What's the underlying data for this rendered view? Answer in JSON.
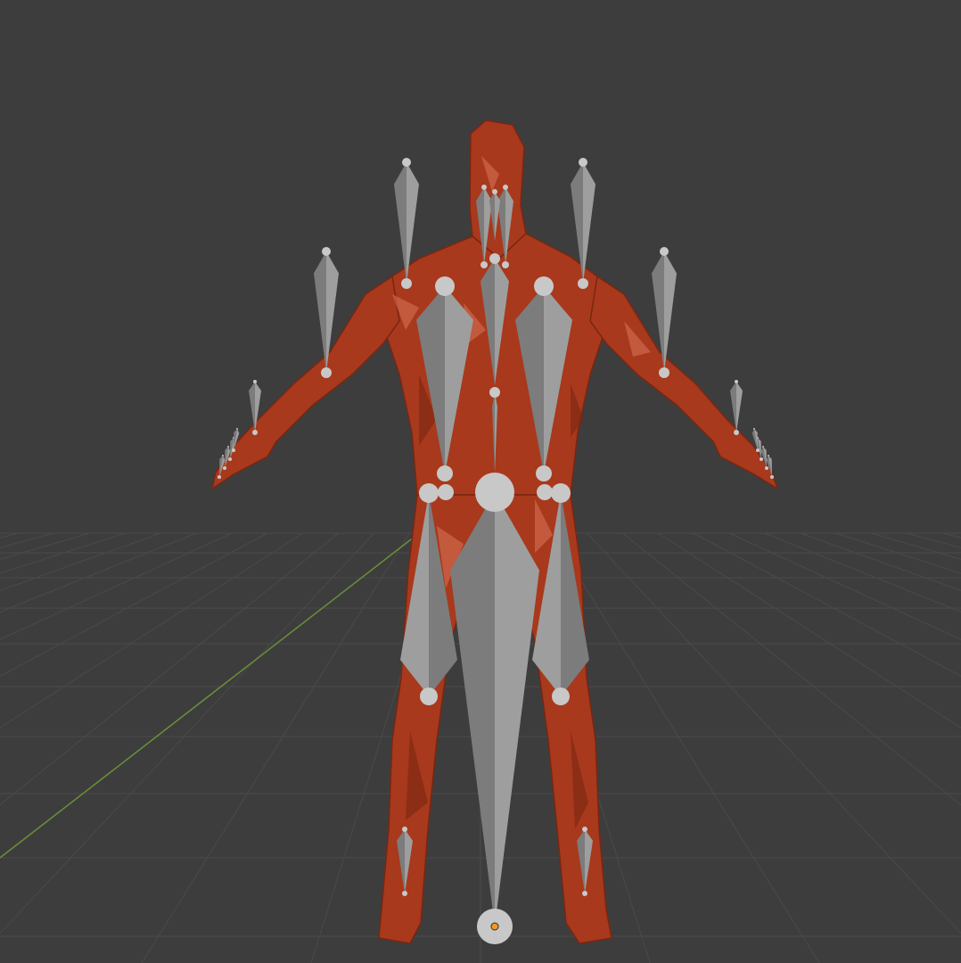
{
  "viewport": {
    "background_color": "#3d3d3d",
    "grid_color": "#4a4a4a",
    "y_axis_color": "#6a8f3a",
    "origin_color": "#f39a1e"
  },
  "mesh": {
    "name": "character-mesh",
    "color": "#a8391c",
    "shadow_color": "#7a2612",
    "highlight_color": "#d9745a"
  },
  "armature": {
    "name": "armature",
    "bone_color": "#9e9e9e",
    "bone_shade": "#7c7c7c",
    "joint_color": "#c8c8c8"
  }
}
